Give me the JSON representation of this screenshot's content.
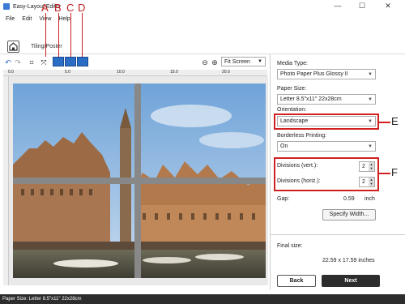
{
  "window": {
    "title": "Easy-Layout Editor",
    "controls": {
      "minimize": "—",
      "maximize": "☐",
      "close": "✕"
    }
  },
  "menu": [
    "File",
    "Edit",
    "View",
    "Help"
  ],
  "ribbon": {
    "tiling_label": "Tiling/Poster"
  },
  "callouts": {
    "top": [
      "A",
      "B",
      "C",
      "D"
    ],
    "e": "E",
    "f": "F"
  },
  "toolbar": {
    "zoom_value": "Fit Screen"
  },
  "ruler": {
    "ticks": [
      "0.0",
      "5.0",
      "10.0",
      "15.0",
      "20.0",
      "25.0"
    ]
  },
  "panel": {
    "media_type_label": "Media Type:",
    "media_type_value": "Photo Paper Plus Glossy II",
    "paper_size_label": "Paper Size:",
    "paper_size_value": "Letter 8.5\"x11\" 22x28cm",
    "orientation_label": "Orientation:",
    "orientation_value": "Landscape",
    "borderless_label": "Borderless Printing:",
    "borderless_value": "On",
    "div_vert_label": "Divisions (vert.):",
    "div_vert_value": "2",
    "div_horiz_label": "Divisions (horiz.):",
    "div_horiz_value": "2",
    "gap_label": "Gap:",
    "gap_value": "0.59",
    "gap_unit": "inch",
    "specify_width_label": "Specify Width...",
    "final_size_label": "Final size:",
    "final_size_value": "22.59 x 17.59 inches",
    "back_label": "Back",
    "next_label": "Next"
  },
  "status": {
    "text": "Paper Size: Letter 8.5\"x11\" 22x28cm"
  },
  "colors": {
    "accent": "#2b6cc4",
    "callout": "#d02020",
    "next_button": "#2d2d2d"
  }
}
